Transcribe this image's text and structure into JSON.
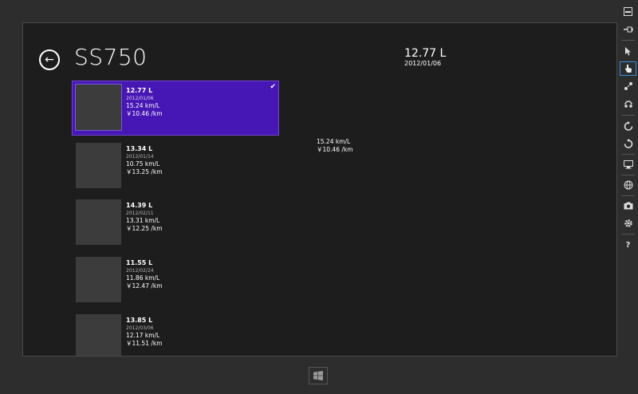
{
  "header": {
    "title": "SS750"
  },
  "detail": {
    "amount": "12.77 L",
    "date": "2012/01/06",
    "efficiency": "15.24 km/L",
    "cost": "￥10.46 /km"
  },
  "entries": [
    {
      "amount": "12.77 L",
      "date": "2012/01/06",
      "efficiency": "15.24 km/L",
      "cost": "￥10.46 /km",
      "selected": true
    },
    {
      "amount": "13.34 L",
      "date": "2012/01/14",
      "efficiency": "10.75 km/L",
      "cost": "￥13.25 /km"
    },
    {
      "amount": "14.39 L",
      "date": "2012/02/11",
      "efficiency": "13.31 km/L",
      "cost": "￥12.25 /km"
    },
    {
      "amount": "11.55 L",
      "date": "2012/02/24",
      "efficiency": "11.86 km/L",
      "cost": "￥12.47 /km"
    },
    {
      "amount": "13.85 L",
      "date": "2012/03/06",
      "efficiency": "12.17 km/L",
      "cost": "￥11.51 /km"
    }
  ],
  "toolbar": {
    "items": [
      {
        "icon": "minimize-icon"
      },
      {
        "icon": "pin-icon"
      },
      {
        "icon": "mouse-pointer-icon"
      },
      {
        "icon": "touch-hand-icon",
        "active": true
      },
      {
        "icon": "pinch-zoom-icon"
      },
      {
        "icon": "rotate-touch-icon"
      },
      {
        "icon": "rotate-clockwise-icon"
      },
      {
        "icon": "rotate-counterclockwise-icon"
      },
      {
        "icon": "resolution-icon"
      },
      {
        "icon": "location-globe-icon"
      },
      {
        "icon": "screenshot-camera-icon"
      },
      {
        "icon": "settings-gear-icon"
      },
      {
        "icon": "help-icon",
        "label": "?"
      }
    ]
  },
  "windows_button": {
    "icon": "windows-logo-icon"
  }
}
